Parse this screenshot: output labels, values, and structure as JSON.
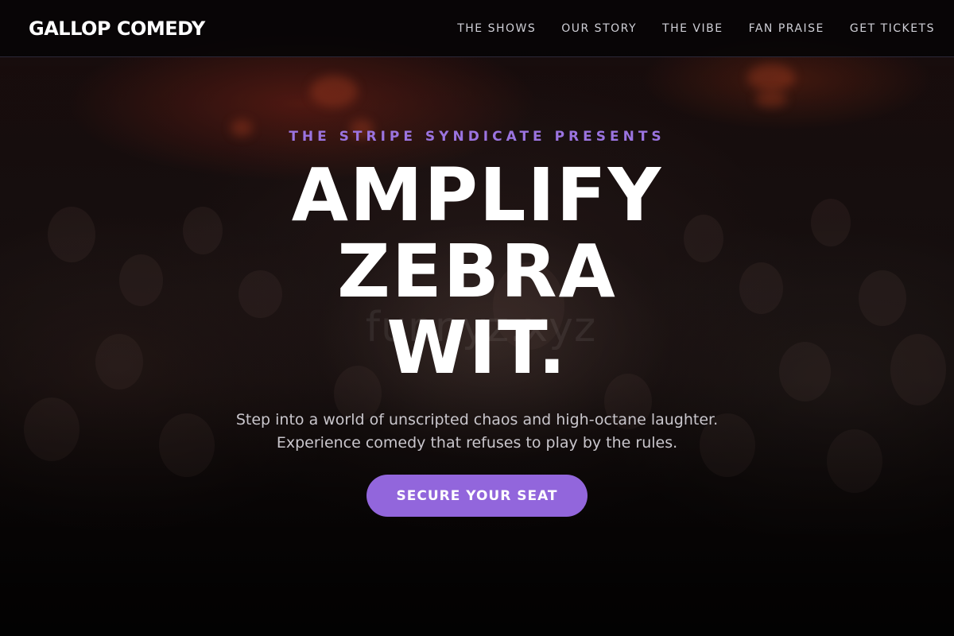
{
  "header": {
    "brand": "GALLOP COMEDY",
    "nav": [
      {
        "label": "THE SHOWS"
      },
      {
        "label": "OUR STORY"
      },
      {
        "label": "THE VIBE"
      },
      {
        "label": "FAN PRAISE"
      },
      {
        "label": "GET TICKETS"
      }
    ]
  },
  "hero": {
    "eyebrow": "THE STRIPE SYNDICATE PRESENTS",
    "headline_lines": [
      "AMPLIFY",
      "ZEBRA",
      "WIT."
    ],
    "watermark": "funnyz.xyz",
    "subcopy_lines": [
      "Step into a world of unscripted chaos and high-octane laughter.",
      "Experience comedy that refuses to play by the rules."
    ],
    "cta_label": "SECURE YOUR SEAT"
  },
  "colors": {
    "accent": "#9266dc",
    "eyebrow": "#9b74e0",
    "background": "#0a0708"
  }
}
